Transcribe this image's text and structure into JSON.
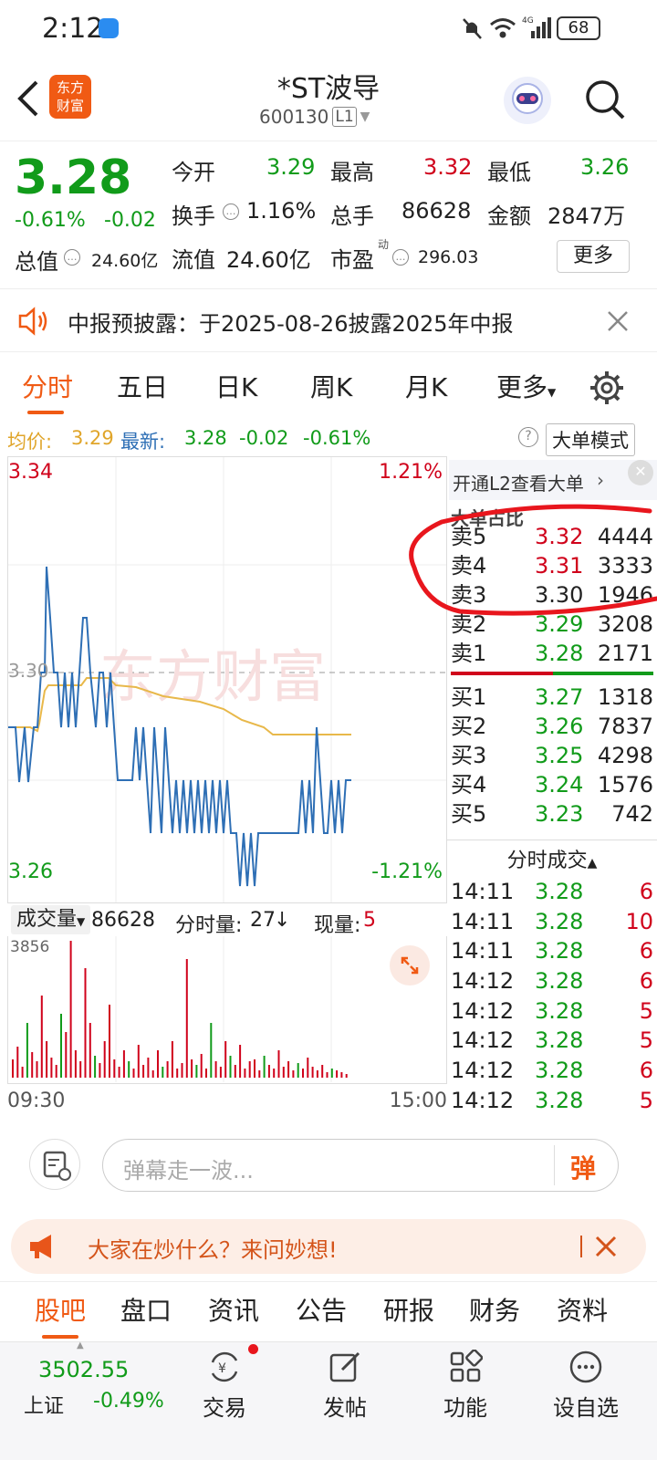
{
  "status_bar": {
    "time": "2:12",
    "battery": "68"
  },
  "header": {
    "title": "*ST波导",
    "code": "600130",
    "level": "L1",
    "logo_text_1": "东方",
    "logo_text_2": "财富"
  },
  "quote": {
    "price": "3.28",
    "change_pct": "-0.61%",
    "change": "-0.02",
    "open_label": "今开",
    "open": "3.29",
    "high_label": "最高",
    "high": "3.32",
    "low_label": "最低",
    "low": "3.26",
    "turnover_label": "换手",
    "turnover": "1.16%",
    "volume_label": "总手",
    "volume": "86628",
    "amount_label": "金额",
    "amount": "2847万",
    "mcap_label": "总值",
    "mcap": "24.60亿",
    "float_label": "流值",
    "float": "24.60亿",
    "pe_label": "市盈",
    "pe_sup": "动",
    "pe": "296.03",
    "more_button": "更多"
  },
  "notice": {
    "text": "中报预披露：于2025-08-26披露2025年中报"
  },
  "tabs": [
    "分时",
    "五日",
    "日K",
    "周K",
    "月K",
    "更多"
  ],
  "avg_bar": {
    "avg_label": "均价:",
    "avg_value": "3.29",
    "latest_label": "最新:",
    "latest_value": "3.28",
    "change": "-0.02",
    "change_pct": "-0.61%",
    "big_order_button": "大单模式"
  },
  "chart": {
    "top_price": "3.34",
    "mid_price": "3.30",
    "bottom_price": "3.26",
    "top_pct": "1.21%",
    "bottom_pct": "-1.21%",
    "watermark": "东方财富"
  },
  "orderbook": {
    "l2_link": "开通L2查看大单",
    "big_ratio_label": "大单占比",
    "asks": [
      {
        "label": "卖5",
        "price": "3.32",
        "qty": "4444"
      },
      {
        "label": "卖4",
        "price": "3.31",
        "qty": "3333"
      },
      {
        "label": "卖3",
        "price": "3.30",
        "qty": "1946"
      },
      {
        "label": "卖2",
        "price": "3.29",
        "qty": "3208"
      },
      {
        "label": "卖1",
        "price": "3.28",
        "qty": "2171"
      }
    ],
    "bids": [
      {
        "label": "买1",
        "price": "3.27",
        "qty": "1318"
      },
      {
        "label": "买2",
        "price": "3.26",
        "qty": "7837"
      },
      {
        "label": "买3",
        "price": "3.25",
        "qty": "4298"
      },
      {
        "label": "买4",
        "price": "3.24",
        "qty": "1576"
      },
      {
        "label": "买5",
        "price": "3.23",
        "qty": "742"
      }
    ]
  },
  "trades": {
    "title": "分时成交",
    "rows": [
      {
        "time": "14:11",
        "price": "3.28",
        "qty": "6"
      },
      {
        "time": "14:11",
        "price": "3.28",
        "qty": "10"
      },
      {
        "time": "14:11",
        "price": "3.28",
        "qty": "6"
      },
      {
        "time": "14:12",
        "price": "3.28",
        "qty": "6"
      },
      {
        "time": "14:12",
        "price": "3.28",
        "qty": "5"
      },
      {
        "time": "14:12",
        "price": "3.28",
        "qty": "5"
      },
      {
        "time": "14:12",
        "price": "3.28",
        "qty": "6"
      },
      {
        "time": "14:12",
        "price": "3.28",
        "qty": "5"
      }
    ]
  },
  "volume_bar": {
    "selector": "成交量",
    "total": "86628",
    "minute_label": "分时量:",
    "minute_value": "27",
    "now_label": "现量:",
    "now_value": "5"
  },
  "volume_chart": {
    "max_label": "3856"
  },
  "time_axis": {
    "start": "09:30",
    "end": "15:00"
  },
  "danmu": {
    "placeholder": "弹幕走一波...",
    "send_label": "弹"
  },
  "promo": {
    "text": "大家在炒什么？来问妙想!"
  },
  "bottom_tabs": [
    "股吧",
    "盘口",
    "资讯",
    "公告",
    "研报",
    "财务",
    "资料"
  ],
  "bottom_nav": {
    "index_value": "3502.55",
    "index_name": "上证",
    "index_change": "-0.49%",
    "items": [
      "交易",
      "发帖",
      "功能",
      "设自选"
    ]
  },
  "colors": {
    "up": "#d0021b",
    "down": "#119b1a",
    "accent": "#f05a14",
    "price_line": "#2e6fb5",
    "avg_line": "#e8b84a"
  }
}
